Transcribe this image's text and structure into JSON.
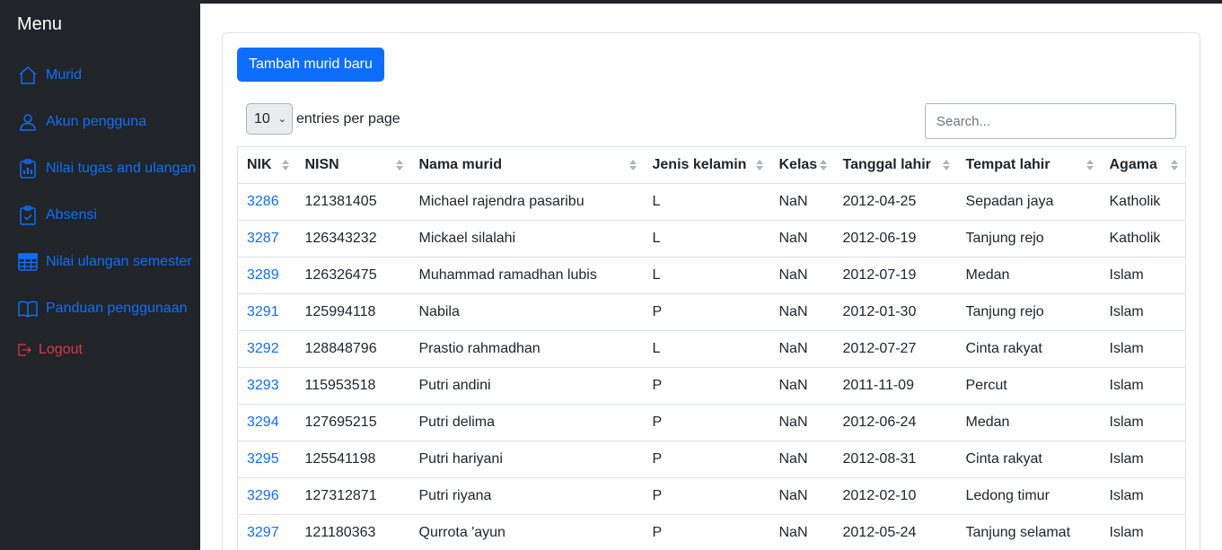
{
  "sidebar": {
    "title": "Menu",
    "items": [
      {
        "label": "Murid",
        "icon": "house-icon"
      },
      {
        "label": "Akun pengguna",
        "icon": "person-icon"
      },
      {
        "label": "Nilai tugas and ulangan",
        "icon": "clipboard-data-icon"
      },
      {
        "label": "Absensi",
        "icon": "clipboard-check-icon"
      },
      {
        "label": "Nilai ulangan semester",
        "icon": "table-icon"
      },
      {
        "label": "Panduan penggunaan",
        "icon": "book-icon"
      }
    ],
    "logout": {
      "label": "Logout",
      "icon": "logout-icon"
    }
  },
  "main": {
    "add_button": "Tambah murid baru",
    "per_page": {
      "value": "10",
      "label": "entries per page"
    },
    "search": {
      "placeholder": "Search..."
    },
    "table": {
      "columns": [
        "NIK",
        "NISN",
        "Nama murid",
        "Jenis kelamin",
        "Kelas",
        "Tanggal lahir",
        "Tempat lahir",
        "Agama"
      ],
      "rows": [
        [
          "3286",
          "121381405",
          "Michael rajendra pasaribu",
          "L",
          "NaN",
          "2012-04-25",
          "Sepadan jaya",
          "Katholik"
        ],
        [
          "3287",
          "126343232",
          "Mickael silalahi",
          "L",
          "NaN",
          "2012-06-19",
          "Tanjung rejo",
          "Katholik"
        ],
        [
          "3289",
          "126326475",
          "Muhammad ramadhan lubis",
          "L",
          "NaN",
          "2012-07-19",
          "Medan",
          "Islam"
        ],
        [
          "3291",
          "125994118",
          "Nabila",
          "P",
          "NaN",
          "2012-01-30",
          "Tanjung rejo",
          "Islam"
        ],
        [
          "3292",
          "128848796",
          "Prastio rahmadhan",
          "L",
          "NaN",
          "2012-07-27",
          "Cinta rakyat",
          "Islam"
        ],
        [
          "3293",
          "115953518",
          "Putri andini",
          "P",
          "NaN",
          "2011-11-09",
          "Percut",
          "Islam"
        ],
        [
          "3294",
          "127695215",
          "Putri delima",
          "P",
          "NaN",
          "2012-06-24",
          "Medan",
          "Islam"
        ],
        [
          "3295",
          "125541198",
          "Putri hariyani",
          "P",
          "NaN",
          "2012-08-31",
          "Cinta rakyat",
          "Islam"
        ],
        [
          "3296",
          "127312871",
          "Putri riyana",
          "P",
          "NaN",
          "2012-02-10",
          "Ledong timur",
          "Islam"
        ],
        [
          "3297",
          "121180363",
          "Qurrota 'ayun",
          "P",
          "NaN",
          "2012-05-24",
          "Tanjung selamat",
          "Islam"
        ]
      ]
    }
  },
  "colors": {
    "sidebar_bg": "#212529",
    "link": "#0d6efd",
    "logout": "#dc3545",
    "primary_button": "#0d6efd"
  }
}
